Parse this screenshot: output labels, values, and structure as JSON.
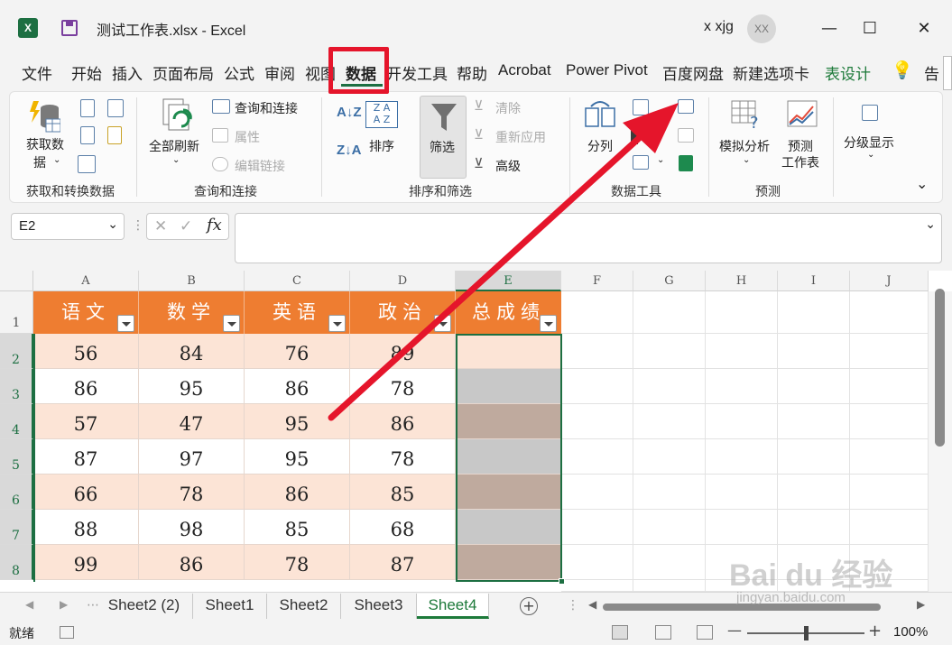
{
  "window": {
    "file_title": "测试工作表.xlsx  -  Excel",
    "user_name": "x xjg",
    "avatar_initials": "XX",
    "minimize": "—",
    "maximize": "☐",
    "close": "✕"
  },
  "menu_tabs": [
    "文件",
    "开始",
    "插入",
    "页面布局",
    "公式",
    "审阅",
    "视图",
    "数据",
    "开发工具",
    "帮助",
    "Acrobat",
    "Power Pivot",
    "百度网盘",
    "新建选项卡",
    "表设计",
    "告"
  ],
  "active_tab": "数据",
  "ribbon": {
    "get_data": "获取数",
    "get_data2": "据",
    "group_get_transform": "获取和转换数据",
    "refresh_all": "全部刷新",
    "queries_connections": "查询和连接",
    "properties": "属性",
    "edit_links": "编辑链接",
    "group_queries": "查询和连接",
    "sort": "排序",
    "filter": "筛选",
    "clear": "清除",
    "reapply": "重新应用",
    "advanced": "高级",
    "group_sort_filter": "排序和筛选",
    "text_to_columns": "分列",
    "group_data_tools": "数据工具",
    "what_if": "模拟分析",
    "forecast_sheet": "预测",
    "forecast_sheet2": "工作表",
    "group_forecast": "预测",
    "outline": "分级显示"
  },
  "formula_bar": {
    "name_box": "E2",
    "fx": "fx",
    "cancel": "✕",
    "enter": "✓",
    "value": ""
  },
  "columns": [
    "A",
    "B",
    "C",
    "D",
    "E",
    "F",
    "G",
    "H",
    "I",
    "J"
  ],
  "rows": [
    "1",
    "2",
    "3",
    "4",
    "5",
    "6",
    "7",
    "8"
  ],
  "table": {
    "headers": [
      "语文",
      "数学",
      "英语",
      "政治",
      "总成绩"
    ],
    "rows": [
      [
        "56",
        "84",
        "76",
        "89",
        ""
      ],
      [
        "86",
        "95",
        "86",
        "78",
        ""
      ],
      [
        "57",
        "47",
        "95",
        "86",
        ""
      ],
      [
        "87",
        "97",
        "95",
        "78",
        ""
      ],
      [
        "66",
        "78",
        "86",
        "85",
        ""
      ],
      [
        "88",
        "98",
        "85",
        "68",
        ""
      ],
      [
        "99",
        "86",
        "78",
        "87",
        ""
      ]
    ],
    "header_color": "#ee7d31",
    "band_color": "#fce4d6",
    "selection_fill_a": "#c8c8c8",
    "selection_fill_b": "#bfaa9e"
  },
  "sheets": [
    "Sheet2 (2)",
    "Sheet1",
    "Sheet2",
    "Sheet3",
    "Sheet4"
  ],
  "active_sheet": "Sheet4",
  "status": {
    "ready": "就绪",
    "zoom": "100%",
    "zoom_minus": "—",
    "zoom_plus": "+"
  },
  "watermark": {
    "brand": "Bai du 经验",
    "url": "jingyan.baidu.com"
  },
  "annotation_color": "#e5152b"
}
